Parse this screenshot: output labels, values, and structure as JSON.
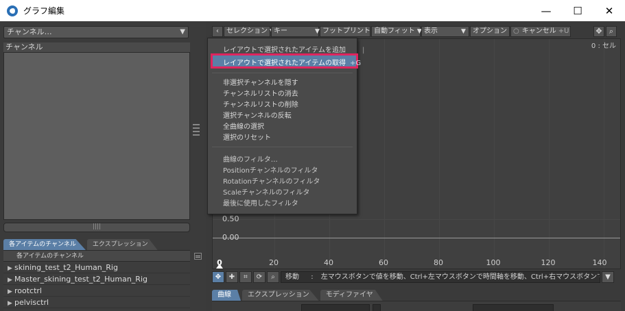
{
  "window": {
    "title": "グラフ編集",
    "minimize": "—",
    "maximize": "☐",
    "close": "✕"
  },
  "left": {
    "channel_dropdown": "チャンネル…",
    "channel_header": "チャンネル",
    "scroll_grip": "||||",
    "tabs": [
      "各アイテムのチャンネル",
      "エクスプレッション"
    ],
    "items_header": "各アイテムのチャンネル",
    "items": [
      "skining_test_t2_Human_Rig",
      "Master_skining_test_t2_Human_Rig",
      "rootctrl",
      "pelvisctrl"
    ]
  },
  "toolbar": {
    "back": "‹",
    "selection": "セレクション",
    "key": "キー",
    "footprint": "フットプリント",
    "autofit": "自動フィット",
    "display": "表示",
    "options": "オプション",
    "cancel": "キャンセル",
    "cancel_shortcut": "+U",
    "cancel_mark": "○",
    "move_icon": "move-icon",
    "zoom_icon": "zoom-icon"
  },
  "graph": {
    "corner_label": "0 : セル",
    "y_labels": [
      "0.50",
      "0.00"
    ],
    "x_ticks": [
      "0",
      "20",
      "40",
      "60",
      "80",
      "100",
      "120",
      "140"
    ]
  },
  "context_menu": {
    "items_group1": [
      {
        "label": "レイアウトで選択されたアイテムを追加",
        "shortcut": "|"
      },
      {
        "label": "レイアウトで選択されたアイテムの取得",
        "shortcut": "+G"
      }
    ],
    "items_group2": [
      "非選択チャンネルを隠す",
      "チャンネルリストの消去",
      "チャンネルリストの削除",
      "選択チャンネルの反転",
      "全曲線の選択",
      "選択のリセット"
    ],
    "items_group3": [
      "曲線のフィルタ…",
      "Positionチャンネルのフィルタ",
      "Rotationチャンネルのフィルタ",
      "Scaleチャンネルのフィルタ",
      "最後に使用したフィルタ"
    ]
  },
  "bottombar": {
    "mode": "移動",
    "separator": ":",
    "hint": "左マウスボタンで値を移動、Ctrl+左マウスボタンで時間軸を移動、Ctrl+右マウスボタンで …",
    "icons": [
      "move-tool-icon",
      "add-key-icon",
      "cut-icon",
      "refresh-icon",
      "zoom-icon"
    ]
  },
  "bottom_tabs": [
    "曲線",
    "エクスプレッション",
    "モディファイヤ"
  ],
  "colors": {
    "accent": "#5b7fa6",
    "highlight_border": "#e0245e"
  }
}
